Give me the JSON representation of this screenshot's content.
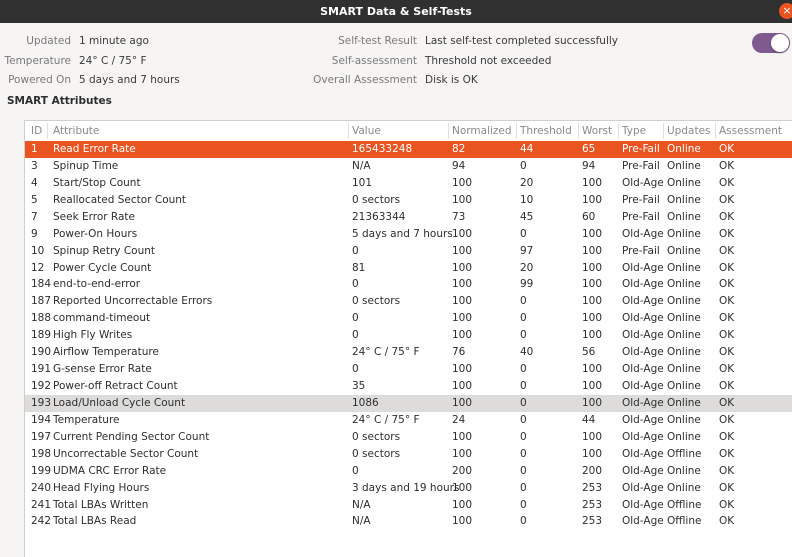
{
  "window": {
    "title": "SMART Data & Self-Tests",
    "close_glyph": "×"
  },
  "info": {
    "left": [
      {
        "label": "Updated",
        "value": "1 minute ago"
      },
      {
        "label": "Temperature",
        "value": "24° C / 75° F"
      },
      {
        "label": "Powered On",
        "value": "5 days and 7 hours"
      }
    ],
    "right": [
      {
        "label": "Self-test Result",
        "value": "Last self-test completed successfully"
      },
      {
        "label": "Self-assessment",
        "value": "Threshold not exceeded"
      },
      {
        "label": "Overall Assessment",
        "value": "Disk is OK"
      }
    ],
    "toggle_on": true,
    "toggle_color": "#7f5a8f"
  },
  "section_title": "SMART Attributes",
  "table": {
    "headers": [
      "ID",
      "Attribute",
      "Value",
      "Normalized",
      "Threshold",
      "Worst",
      "Type",
      "Updates",
      "Assessment"
    ],
    "selected_color": "#e95420",
    "rows": [
      [
        "1",
        "Read Error Rate",
        "165433248",
        "82",
        "44",
        "65",
        "Pre-Fail",
        "Online",
        "OK"
      ],
      [
        "3",
        "Spinup Time",
        "N/A",
        "94",
        "0",
        "94",
        "Pre-Fail",
        "Online",
        "OK"
      ],
      [
        "4",
        "Start/Stop Count",
        "101",
        "100",
        "20",
        "100",
        "Old-Age",
        "Online",
        "OK"
      ],
      [
        "5",
        "Reallocated Sector Count",
        "0 sectors",
        "100",
        "10",
        "100",
        "Pre-Fail",
        "Online",
        "OK"
      ],
      [
        "7",
        "Seek Error Rate",
        "21363344",
        "73",
        "45",
        "60",
        "Pre-Fail",
        "Online",
        "OK"
      ],
      [
        "9",
        "Power-On Hours",
        "5 days and 7 hours",
        "100",
        "0",
        "100",
        "Old-Age",
        "Online",
        "OK"
      ],
      [
        "10",
        "Spinup Retry Count",
        "0",
        "100",
        "97",
        "100",
        "Pre-Fail",
        "Online",
        "OK"
      ],
      [
        "12",
        "Power Cycle Count",
        "81",
        "100",
        "20",
        "100",
        "Old-Age",
        "Online",
        "OK"
      ],
      [
        "184",
        "end-to-end-error",
        "0",
        "100",
        "99",
        "100",
        "Old-Age",
        "Online",
        "OK"
      ],
      [
        "187",
        "Reported Uncorrectable Errors",
        "0 sectors",
        "100",
        "0",
        "100",
        "Old-Age",
        "Online",
        "OK"
      ],
      [
        "188",
        "command-timeout",
        "0",
        "100",
        "0",
        "100",
        "Old-Age",
        "Online",
        "OK"
      ],
      [
        "189",
        "High Fly Writes",
        "0",
        "100",
        "0",
        "100",
        "Old-Age",
        "Online",
        "OK"
      ],
      [
        "190",
        "Airflow Temperature",
        "24° C / 75° F",
        "76",
        "40",
        "56",
        "Old-Age",
        "Online",
        "OK"
      ],
      [
        "191",
        "G-sense Error Rate",
        "0",
        "100",
        "0",
        "100",
        "Old-Age",
        "Online",
        "OK"
      ],
      [
        "192",
        "Power-off Retract Count",
        "35",
        "100",
        "0",
        "100",
        "Old-Age",
        "Online",
        "OK"
      ],
      [
        "193",
        "Load/Unload Cycle Count",
        "1086",
        "100",
        "0",
        "100",
        "Old-Age",
        "Online",
        "OK"
      ],
      [
        "194",
        "Temperature",
        "24° C / 75° F",
        "24",
        "0",
        "44",
        "Old-Age",
        "Online",
        "OK"
      ],
      [
        "197",
        "Current Pending Sector Count",
        "0 sectors",
        "100",
        "0",
        "100",
        "Old-Age",
        "Online",
        "OK"
      ],
      [
        "198",
        "Uncorrectable Sector Count",
        "0 sectors",
        "100",
        "0",
        "100",
        "Old-Age",
        "Offline",
        "OK"
      ],
      [
        "199",
        "UDMA CRC Error Rate",
        "0",
        "200",
        "0",
        "200",
        "Old-Age",
        "Online",
        "OK"
      ],
      [
        "240",
        "Head Flying Hours",
        "3 days and 19 hours",
        "100",
        "0",
        "253",
        "Old-Age",
        "Online",
        "OK"
      ],
      [
        "241",
        "Total LBAs Written",
        "N/A",
        "100",
        "0",
        "253",
        "Old-Age",
        "Offline",
        "OK"
      ],
      [
        "242",
        "Total LBAs Read",
        "N/A",
        "100",
        "0",
        "253",
        "Old-Age",
        "Offline",
        "OK"
      ]
    ],
    "selected_row": 0,
    "hover_row": 15
  }
}
